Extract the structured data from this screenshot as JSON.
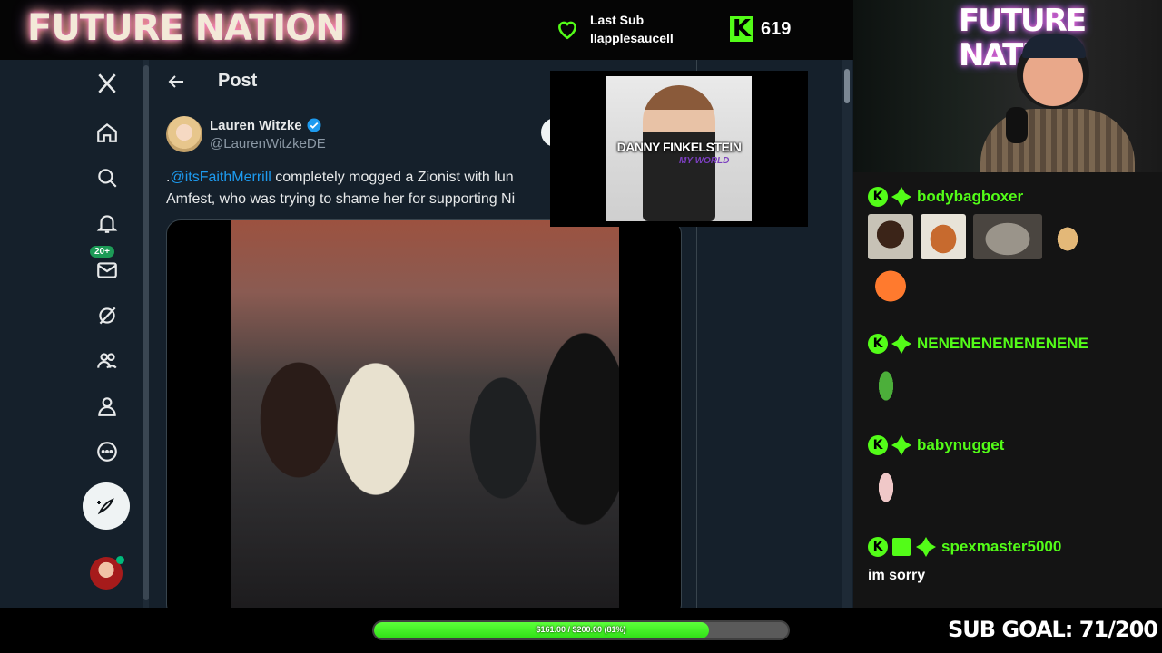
{
  "stream": {
    "brand_title": "FUTURE NATION",
    "last_sub_label": "Last Sub",
    "last_sub_user": "llapplesaucell",
    "kick_viewers": "619",
    "sub_goal_text": "SUB GOAL: 71/200",
    "goal_bar_label": "$161.00 / $200.00 (81%)",
    "goal_progress": 0.81,
    "cam_sign": "FUTURE NATION",
    "accent_color": "#53fc18"
  },
  "x_app": {
    "nav_items": [
      {
        "name": "x-logo-icon"
      },
      {
        "name": "home-icon"
      },
      {
        "name": "explore-icon"
      },
      {
        "name": "notifications-icon"
      },
      {
        "name": "messages-icon",
        "badge": "20+"
      },
      {
        "name": "grok-icon"
      },
      {
        "name": "communities-icon"
      },
      {
        "name": "profile-icon"
      },
      {
        "name": "more-icon"
      }
    ],
    "header_title": "Post",
    "author": {
      "name": "Lauren Witzke",
      "handle": "@LaurenWitzkeDE"
    },
    "tweet": {
      "prefix": ".",
      "mention": "@itsFaithMerrill",
      "text_line1": " completely mogged a Zionist with lun",
      "text_line2": "Amfest, who was trying to shame her for supporting Ni"
    }
  },
  "album": {
    "artist": "DANNY FINKELSTEIN",
    "title": "MY WORLD"
  },
  "chat": [
    {
      "user": "bodybagboxer",
      "emotes": [
        "dog-emote",
        "squirrel-emote",
        "cat-emote",
        "doge-emote",
        "peach-emote"
      ]
    },
    {
      "user": "NENENENENENENENE",
      "emotes": [
        "frog-dance-emote"
      ]
    },
    {
      "user": "babynugget",
      "emotes": [
        "hamster-dance-emote"
      ]
    },
    {
      "user": "spexmaster5000",
      "gift": true,
      "text": "im sorry"
    }
  ]
}
